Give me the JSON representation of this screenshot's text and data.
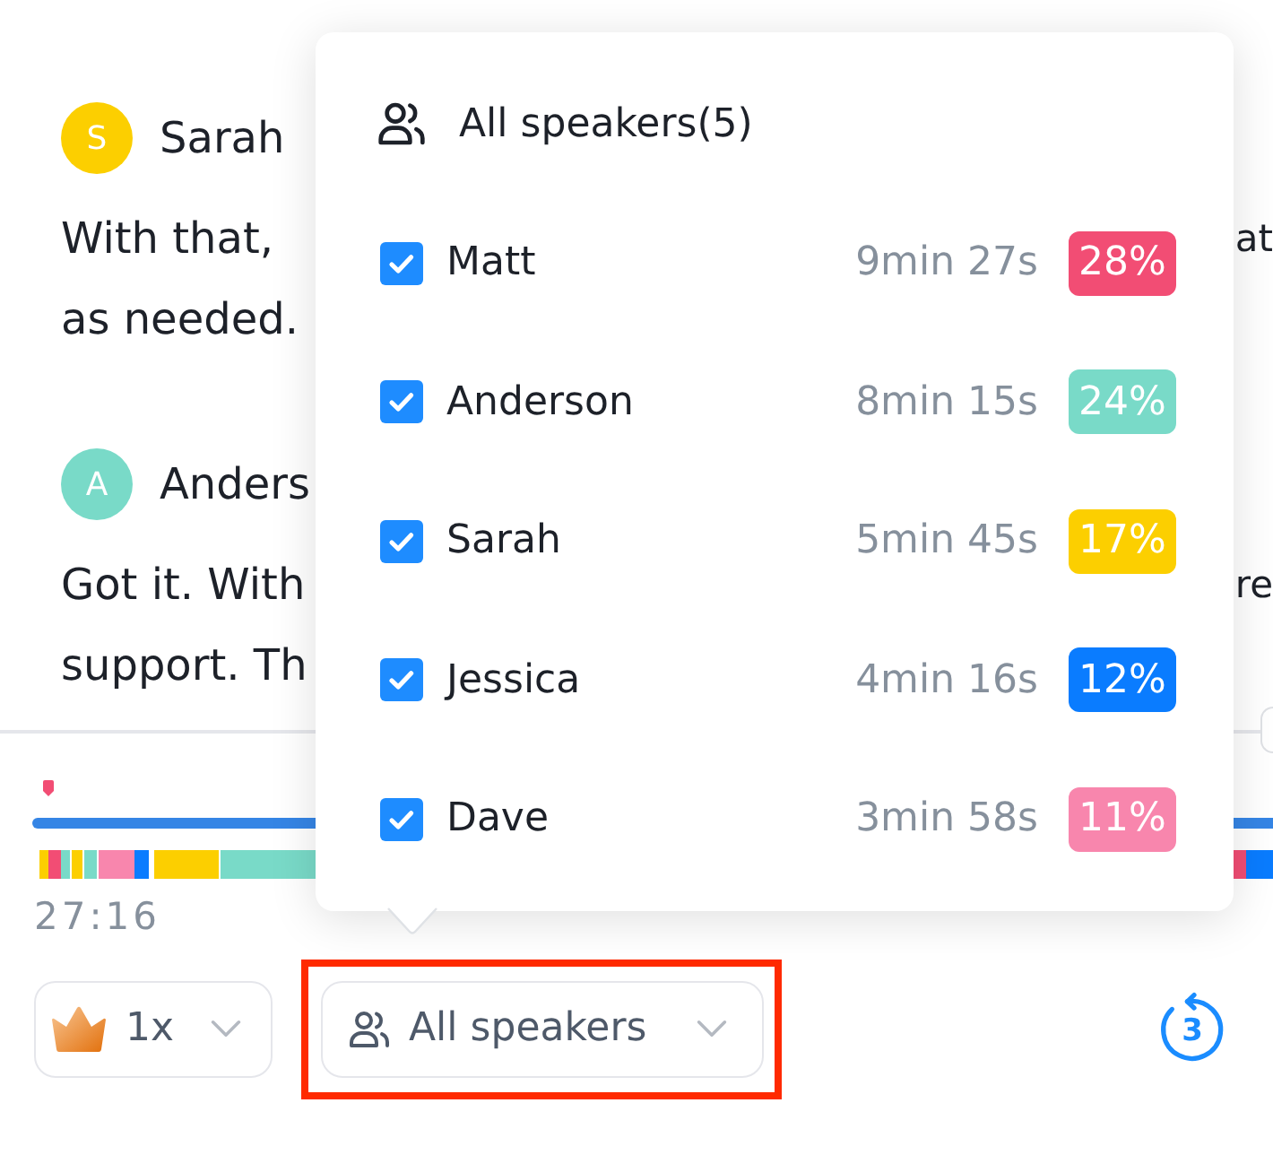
{
  "transcript": [
    {
      "speaker": "Sarah",
      "initial": "S",
      "color": "#fccf00",
      "lines": [
        {
          "text": "With that,",
          "tail": "at"
        },
        {
          "text": "as needed."
        }
      ]
    },
    {
      "speaker": "Anders",
      "initial": "A",
      "color": "#79dac8",
      "lines": [
        {
          "text": "Got it. With",
          "tail": "re"
        },
        {
          "text": "support. Th"
        }
      ]
    }
  ],
  "speaker_popup": {
    "title": "All speakers(5)",
    "speakers": [
      {
        "name": "Matt",
        "checked": true,
        "duration": "9min 27s",
        "share": "28%",
        "color": "#f24d74"
      },
      {
        "name": "Anderson",
        "checked": true,
        "duration": "8min 15s",
        "share": "24%",
        "color": "#79dac8"
      },
      {
        "name": "Sarah",
        "checked": true,
        "duration": "5min 45s",
        "share": "17%",
        "color": "#fccf00"
      },
      {
        "name": "Jessica",
        "checked": true,
        "duration": "4min 16s",
        "share": "12%",
        "color": "#0a7cff"
      },
      {
        "name": "Dave",
        "checked": true,
        "duration": "3min 58s",
        "share": "11%",
        "color": "#f886ad"
      }
    ]
  },
  "timeline": {
    "time": "27:16"
  },
  "controls": {
    "speed": {
      "label": "1x"
    },
    "speaker_filter": {
      "label": "All speakers",
      "highlighted": true
    },
    "skip_back": {
      "label": "3"
    }
  }
}
